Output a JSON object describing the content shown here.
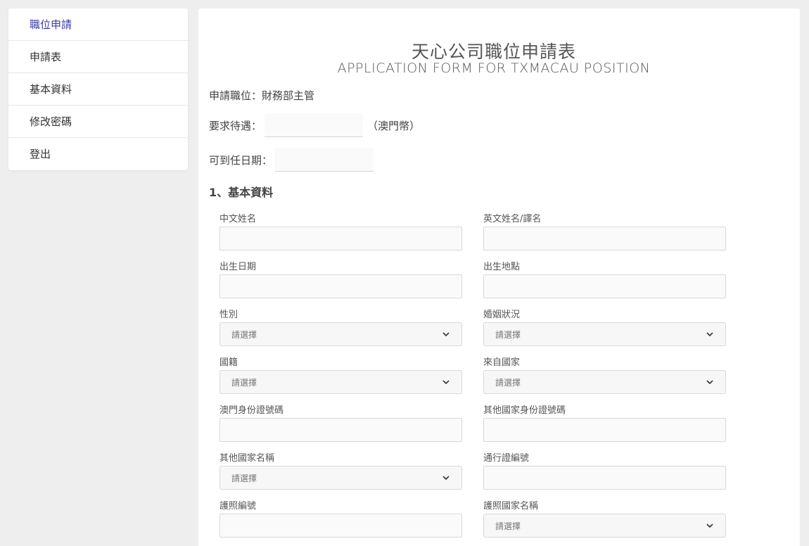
{
  "sidebar": {
    "items": [
      {
        "label": "職位申請"
      },
      {
        "label": "申請表"
      },
      {
        "label": "基本資料"
      },
      {
        "label": "修改密碼"
      },
      {
        "label": "登出"
      }
    ],
    "active_color": "#3a3aaa"
  },
  "form": {
    "title": "天心公司職位申請表",
    "subtitle": "APPLICATION FORM FOR TXMACAU POSITION",
    "position_label": "申請職位：財務部主管",
    "salary_label": "要求待遇：",
    "salary_value": "",
    "salary_unit": "（澳門幣）",
    "start_date_label": "可到任日期：",
    "start_date_value": ""
  },
  "section1": {
    "title": "1、基本資料",
    "chinese_name": {
      "label": "中文姓名",
      "value": ""
    },
    "english_name": {
      "label": "英文姓名/譯名",
      "value": ""
    },
    "birth_date": {
      "label": "出生日期",
      "value": ""
    },
    "birth_place": {
      "label": "出生地點",
      "value": ""
    },
    "gender": {
      "label": "性別",
      "value": "請選擇"
    },
    "marital_status": {
      "label": "婚姻狀況",
      "value": "請選擇"
    },
    "nationality": {
      "label": "國籍",
      "value": "請選擇"
    },
    "from_country": {
      "label": "來自國家",
      "value": "請選擇"
    },
    "macau_id": {
      "label": "澳門身份證號碼",
      "value": ""
    },
    "other_id": {
      "label": "其他國家身份證號碼",
      "value": ""
    },
    "other_country_name": {
      "label": "其他國家名稱",
      "value": "請選擇"
    },
    "permit_no": {
      "label": "通行證編號",
      "value": ""
    },
    "passport_no": {
      "label": "護照編號",
      "value": ""
    },
    "passport_country": {
      "label": "護照國家名稱",
      "value": "請選擇"
    }
  }
}
